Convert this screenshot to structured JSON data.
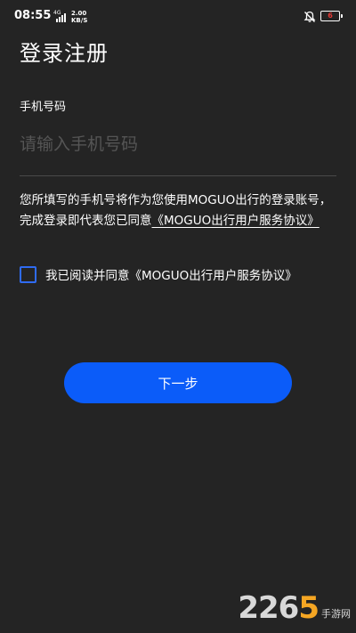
{
  "status_bar": {
    "time": "08:55",
    "network": "4G",
    "speed_value": "2.00",
    "speed_unit": "KB/S",
    "battery_level": "6",
    "battery_color": "#e53935",
    "icons": [
      "signal-icon",
      "silent-icon",
      "battery-icon"
    ]
  },
  "header": {
    "title": "登录注册"
  },
  "form": {
    "phone_label": "手机号码",
    "phone_placeholder": "请输入手机号码",
    "phone_value": ""
  },
  "notice": {
    "text": "您所填写的手机号将作为您使用MOGUO出行的登录账号，完成登录即代表您已同意",
    "link": "《MOGUO出行用户服务协议》"
  },
  "agreement": {
    "checked": false,
    "label": "我已阅读并同意《MOGUO出行用户服务协议》"
  },
  "actions": {
    "next_label": "下一步",
    "accent_color": "#0b5cf9"
  },
  "watermark": {
    "brand_prefix": "226",
    "brand_accent": "5",
    "sub_text": "手游网"
  }
}
